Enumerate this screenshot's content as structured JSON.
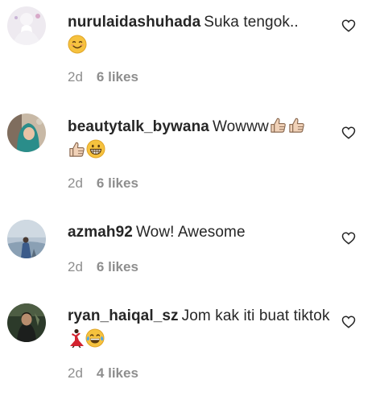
{
  "comments": [
    {
      "username": "nurulaidashuhada",
      "text": "Suka tengok..",
      "time": "2d",
      "likes": "6 likes",
      "emojis": [
        "smiling-face-icon"
      ]
    },
    {
      "username": "beautytalk_bywana",
      "text": "Wowww",
      "time": "2d",
      "likes": "6 likes",
      "emojis": [
        "thumbs-up-icon",
        "thumbs-up-icon",
        "thumbs-up-icon",
        "grinning-face-icon"
      ]
    },
    {
      "username": "azmah92",
      "text": "Wow! Awesome",
      "time": "2d",
      "likes": "6 likes",
      "emojis": []
    },
    {
      "username": "ryan_haiqal_sz",
      "text": "Jom kak iti buat tiktok",
      "time": "2d",
      "likes": "4 likes",
      "emojis": [
        "dancer-icon",
        "tears-of-joy-icon"
      ]
    }
  ],
  "icons": {
    "like": "heart-outline-icon"
  },
  "colors": {
    "text": "#262626",
    "muted": "#8e8e8e",
    "emoji_yellow": "#f6c23e",
    "thumb_skin": "#f1d2b8",
    "dancer_red": "#d3232f"
  }
}
